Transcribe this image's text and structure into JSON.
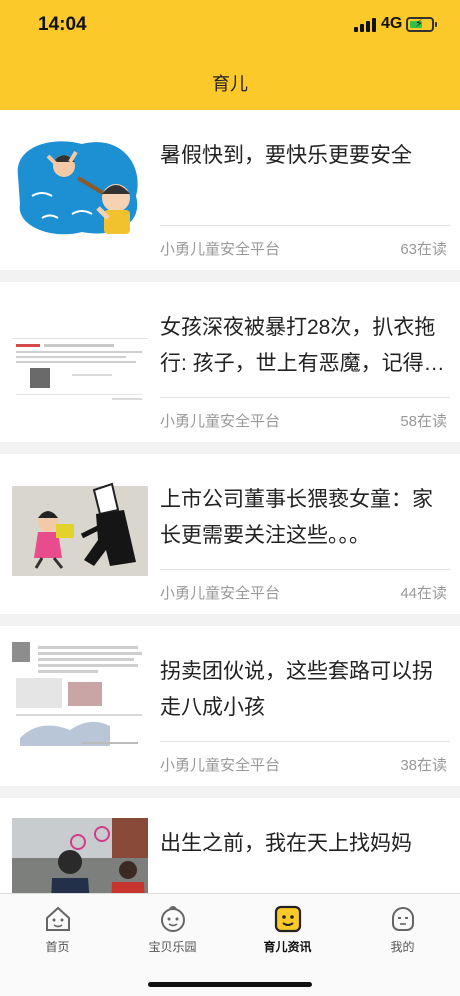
{
  "status_bar": {
    "time": "14:04",
    "network": "4G"
  },
  "header": {
    "title": "育儿"
  },
  "articles": [
    {
      "title": "暑假快到，要快乐更要安全",
      "source": "小勇儿童安全平台",
      "readers": "63在读"
    },
    {
      "title": "女孩深夜被暴打28次，扒衣拖行: 孩子，世上有恶魔，记得…",
      "source": "小勇儿童安全平台",
      "readers": "58在读"
    },
    {
      "title": "上市公司董事长猥亵女童：家长更需要关注这些。。。",
      "source": "小勇儿童安全平台",
      "readers": "44在读"
    },
    {
      "title": "拐卖团伙说，这些套路可以拐走八成小孩",
      "source": "小勇儿童安全平台",
      "readers": "38在读"
    },
    {
      "title": "出生之前，我在天上找妈妈",
      "source": "",
      "readers": ""
    }
  ],
  "tabbar": {
    "items": [
      {
        "label": "首页",
        "icon": "home-icon"
      },
      {
        "label": "宝贝乐园",
        "icon": "baby-face-icon"
      },
      {
        "label": "育儿资讯",
        "icon": "parenting-news-icon",
        "active": true
      },
      {
        "label": "我的",
        "icon": "profile-icon"
      }
    ]
  },
  "colors": {
    "accent": "#fcc92a",
    "battery": "#31c24a",
    "meta_text": "#999999"
  }
}
